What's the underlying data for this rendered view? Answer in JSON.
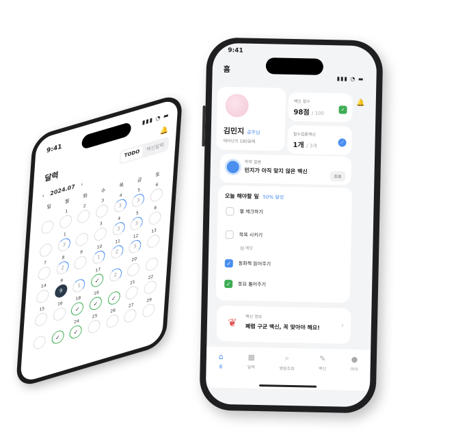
{
  "left_phone": {
    "time": "9:41",
    "title": "달력",
    "toggle": [
      "TODO",
      "백신달력"
    ],
    "month": "2024.07",
    "month_prev": "‹",
    "month_next": "›",
    "weekdays": [
      "일",
      "월",
      "화",
      "수",
      "목",
      "금",
      "토"
    ],
    "days": [
      {
        "n": "",
        "s": "empty"
      },
      {
        "n": "1",
        "s": "empty"
      },
      {
        "n": "2",
        "s": "empty"
      },
      {
        "n": "3",
        "s": "empty"
      },
      {
        "n": "4",
        "s": "part",
        "v": "3"
      },
      {
        "n": "5",
        "s": "part",
        "v": "3"
      },
      {
        "n": "6",
        "s": "empty"
      },
      {
        "n": "",
        "s": "empty"
      },
      {
        "n": "1",
        "s": "part",
        "v": "3"
      },
      {
        "n": "",
        "s": "empty"
      },
      {
        "n": "3",
        "s": "empty"
      },
      {
        "n": "4",
        "s": "part",
        "v": "3"
      },
      {
        "n": "5",
        "s": "part",
        "v": "3"
      },
      {
        "n": "6",
        "s": "empty"
      },
      {
        "n": "7",
        "s": "empty"
      },
      {
        "n": "8",
        "s": "part",
        "v": "2"
      },
      {
        "n": "9",
        "s": "empty"
      },
      {
        "n": "10",
        "s": "part",
        "v": "1"
      },
      {
        "n": "11",
        "s": "part",
        "v": "2"
      },
      {
        "n": "12",
        "s": "part",
        "v": "3"
      },
      {
        "n": "13",
        "s": "empty"
      },
      {
        "n": "14",
        "s": "empty"
      },
      {
        "n": "9",
        "s": "today",
        "v": "9"
      },
      {
        "n": "",
        "s": "part",
        "v": "1"
      },
      {
        "n": "17",
        "s": "done"
      },
      {
        "n": "",
        "s": "part",
        "v": "2"
      },
      {
        "n": "20",
        "s": "empty"
      },
      {
        "n": "",
        "s": "empty"
      },
      {
        "n": "15",
        "s": "empty"
      },
      {
        "n": "16",
        "s": "empty"
      },
      {
        "n": "18",
        "s": "done"
      },
      {
        "n": "19",
        "s": "done"
      },
      {
        "n": "",
        "s": "done"
      },
      {
        "n": "21",
        "s": "empty"
      },
      {
        "n": "22",
        "s": "empty"
      },
      {
        "n": "",
        "s": "empty"
      },
      {
        "n": "",
        "s": "done"
      },
      {
        "n": "24",
        "s": "done"
      },
      {
        "n": "25",
        "s": "empty"
      },
      {
        "n": "26",
        "s": "empty"
      },
      {
        "n": "27",
        "s": "empty"
      },
      {
        "n": "29",
        "s": "empty"
      }
    ]
  },
  "right_phone": {
    "time": "9:41",
    "header_title": "홈",
    "profile": {
      "name": "김민지",
      "nickname": "공주님",
      "birth": "태어난지 180일째"
    },
    "vaccine_score": {
      "label": "백신 점수",
      "value": "98점",
      "total": "/ 100"
    },
    "required_vaccine": {
      "label": "필수접종백신",
      "value": "1개",
      "total": "/ 3개"
    },
    "disease": {
      "label": "취약 질병",
      "text": "민지가 아직 맞지 않은 백신",
      "button": "조회"
    },
    "todo": {
      "title": "오늘 해야할 일",
      "progress": "50% 달성",
      "items": [
        {
          "label": "열 체크하기",
          "state": "empty"
        },
        {
          "label": "목욕 시키기",
          "state": "empty",
          "memo": "메모"
        },
        {
          "label": "동화책 읽어주기",
          "state": "blue"
        },
        {
          "label": "동요 틀어주기",
          "state": "green"
        }
      ]
    },
    "vaccine_info": {
      "label": "백신 정보",
      "text": "폐렴 구균 백신, 꼭 맞아야 해요!"
    },
    "tabs": [
      {
        "label": "홈",
        "icon": "home-icon",
        "glyph": "⌂",
        "active": true
      },
      {
        "label": "달력",
        "icon": "calendar-icon",
        "glyph": "▦",
        "active": false
      },
      {
        "label": "병원조회",
        "icon": "search-icon",
        "glyph": "⌕",
        "active": false
      },
      {
        "label": "백신",
        "icon": "syringe-icon",
        "glyph": "✎",
        "active": false
      },
      {
        "label": "마이",
        "icon": "profile-icon",
        "glyph": "●",
        "active": false
      }
    ]
  }
}
